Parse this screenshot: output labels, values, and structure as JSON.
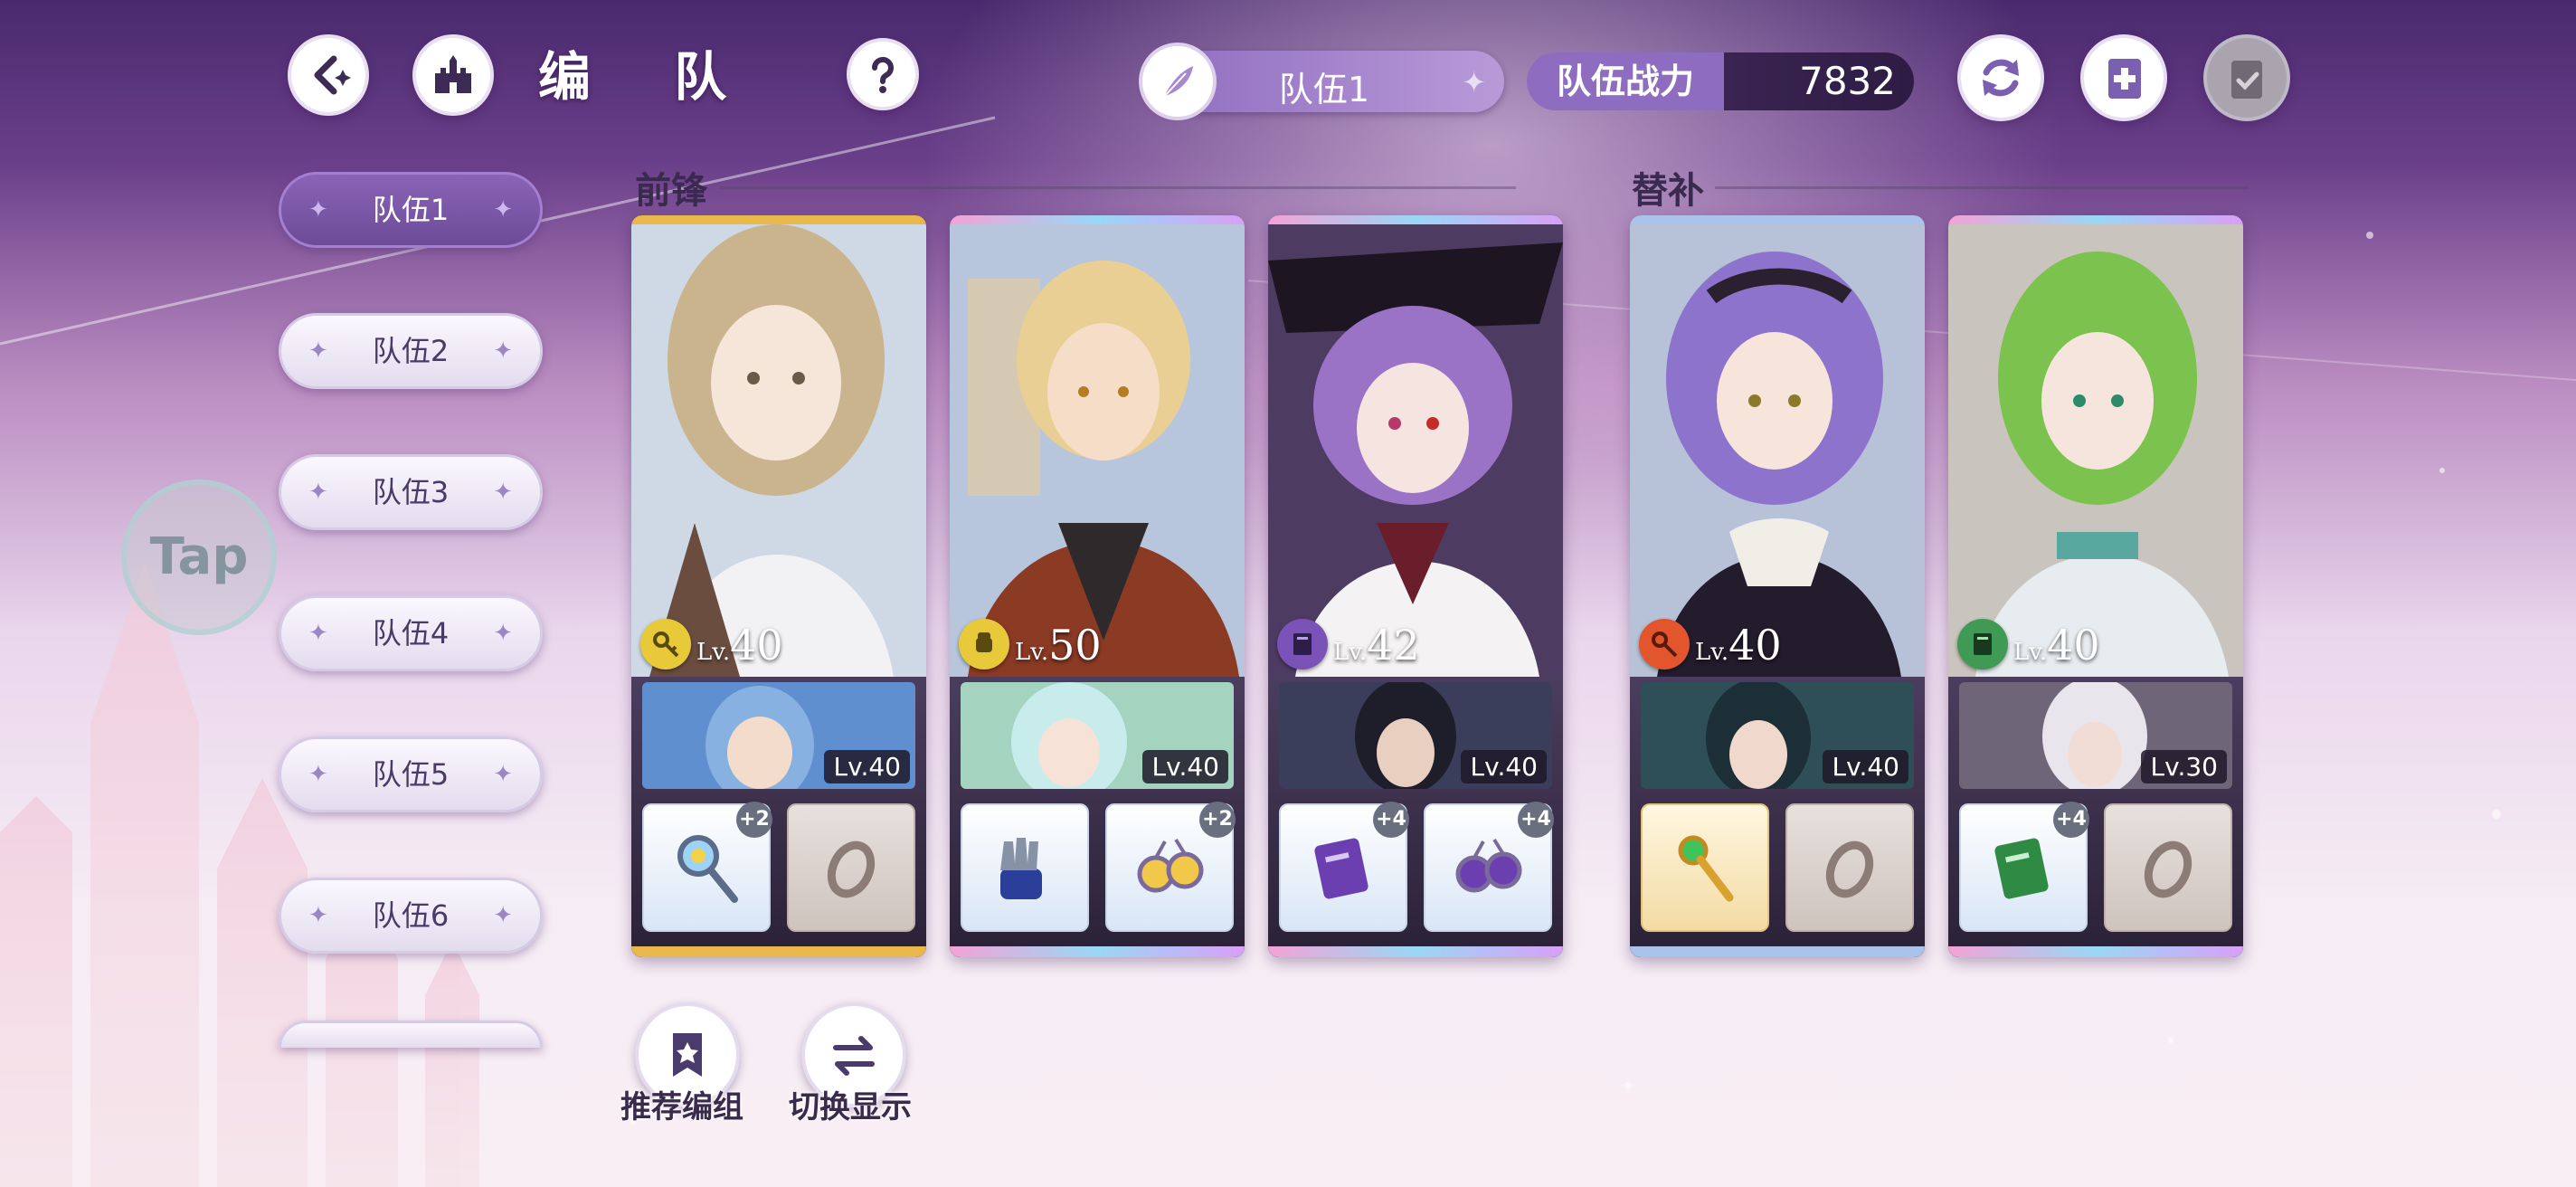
{
  "header": {
    "title": "编 队",
    "team_name": "队伍1",
    "power_label": "队伍战力",
    "power_value": "7832"
  },
  "sidebar": {
    "tabs": [
      {
        "label": "队伍1",
        "active": true
      },
      {
        "label": "队伍2",
        "active": false
      },
      {
        "label": "队伍3",
        "active": false
      },
      {
        "label": "队伍4",
        "active": false
      },
      {
        "label": "队伍5",
        "active": false
      },
      {
        "label": "队伍6",
        "active": false
      }
    ],
    "tap_label": "Tap"
  },
  "sections": {
    "front_label": "前锋",
    "sub_label": "替补"
  },
  "cards": [
    {
      "level_prefix": "Lv.",
      "level": "40",
      "element_color": "#e8c93a",
      "element_icon": "key-icon",
      "sub_level": "Lv.40",
      "slot1": {
        "item": "magnifier-staff-icon",
        "plus": "+2"
      },
      "slot2": {
        "item": "ring-icon",
        "plus": ""
      }
    },
    {
      "level_prefix": "Lv.",
      "level": "50",
      "element_color": "#e8c93a",
      "element_icon": "fist-icon",
      "sub_level": "Lv.40",
      "slot1": {
        "item": "gauntlet-icon",
        "plus": ""
      },
      "slot2": {
        "item": "earrings-icon",
        "plus": "+2"
      }
    },
    {
      "level_prefix": "Lv.",
      "level": "42",
      "element_color": "#7a52b8",
      "element_icon": "book-icon",
      "sub_level": "Lv.40",
      "slot1": {
        "item": "purple-book-icon",
        "plus": "+4"
      },
      "slot2": {
        "item": "earrings-icon",
        "plus": "+4"
      }
    },
    {
      "level_prefix": "Lv.",
      "level": "40",
      "element_color": "#e2552d",
      "element_icon": "key-icon",
      "sub_level": "Lv.40",
      "slot1": {
        "item": "gold-scepter-icon",
        "plus": ""
      },
      "slot2": {
        "item": "ring-icon",
        "plus": ""
      }
    },
    {
      "level_prefix": "Lv.",
      "level": "40",
      "element_color": "#3e9a55",
      "element_icon": "book-icon",
      "sub_level": "Lv.30",
      "slot1": {
        "item": "green-book-icon",
        "plus": "+4"
      },
      "slot2": {
        "item": "ring-icon",
        "plus": ""
      }
    }
  ],
  "bottom": {
    "recommend_label": "推荐编组",
    "toggle_label": "切换显示"
  }
}
